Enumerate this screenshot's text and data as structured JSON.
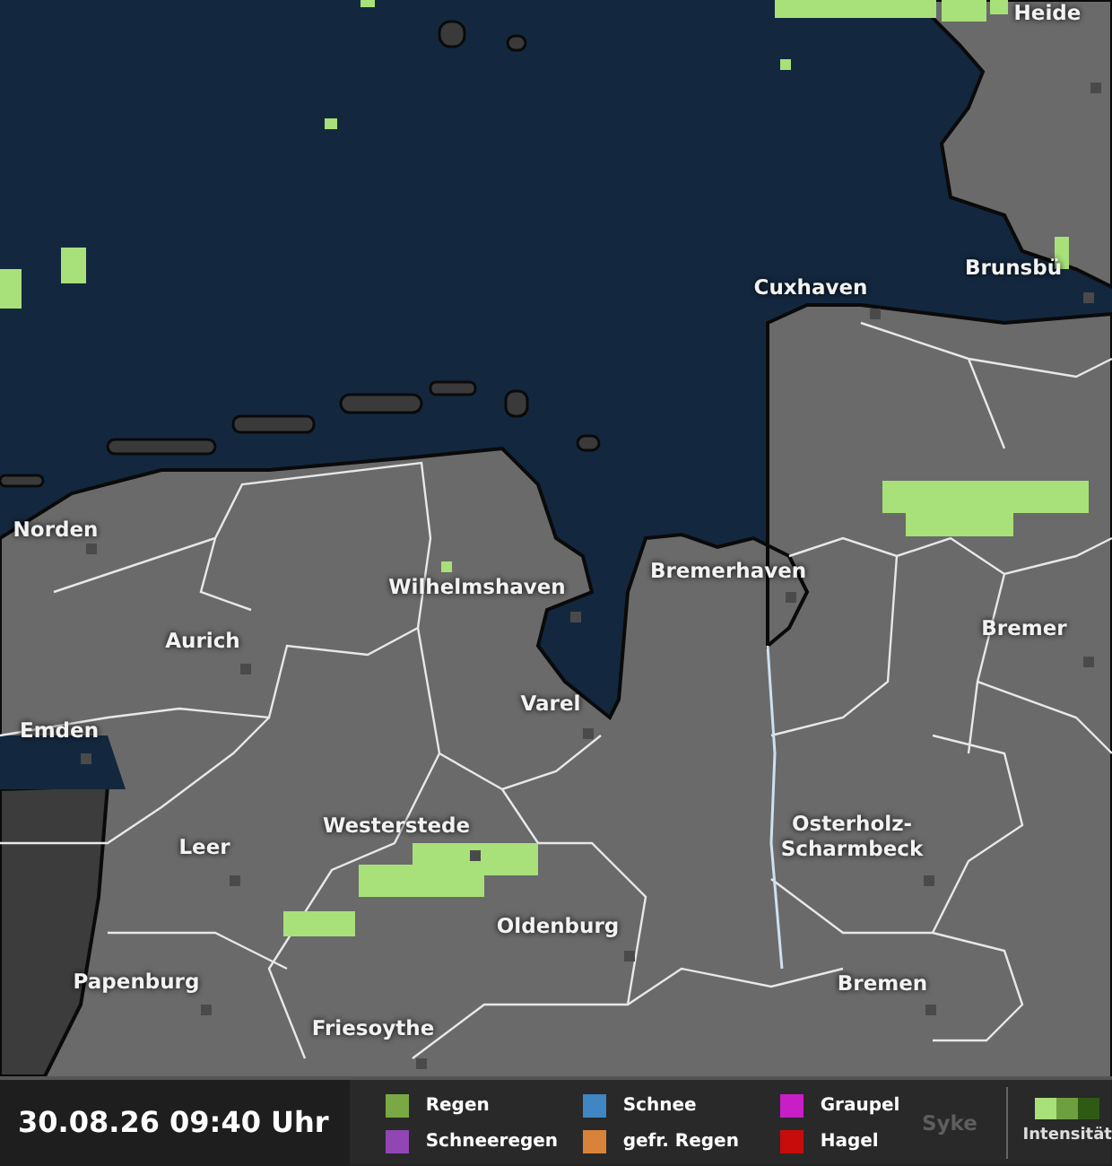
{
  "map": {
    "labels": [
      {
        "name": "Heide"
      },
      {
        "name": "Brunsbü"
      },
      {
        "name": "Cuxhaven"
      },
      {
        "name": "Norden"
      },
      {
        "name": "Wilhelmshaven"
      },
      {
        "name": "Bremerhaven"
      },
      {
        "name": "Bremer"
      },
      {
        "name": "Aurich"
      },
      {
        "name": "Emden"
      },
      {
        "name": "Varel"
      },
      {
        "name": "Leer"
      },
      {
        "name": "Westerstede"
      },
      {
        "name": "Osterholz-Scharmbeck"
      },
      {
        "name": "Oldenburg"
      },
      {
        "name": "Papenburg"
      },
      {
        "name": "Bremen"
      },
      {
        "name": "Friesoythe"
      },
      {
        "name": "Syke"
      }
    ]
  },
  "status_bar": {
    "timestamp": "30.08.26 09:40 Uhr",
    "legend": [
      {
        "label": "Regen",
        "color": "#7aa844"
      },
      {
        "label": "Schneeregen",
        "color": "#9146b4"
      },
      {
        "label": "Schnee",
        "color": "#3f86c2"
      },
      {
        "label": "gefr. Regen",
        "color": "#d9823a"
      },
      {
        "label": "Graupel",
        "color": "#c81ec8"
      },
      {
        "label": "Hagel",
        "color": "#c80c0c"
      }
    ],
    "intensity": {
      "label": "Intensität",
      "levels": [
        {
          "color": "#a8e07a"
        },
        {
          "color": "#6e9e40"
        },
        {
          "color": "#2e5a14"
        }
      ]
    }
  }
}
